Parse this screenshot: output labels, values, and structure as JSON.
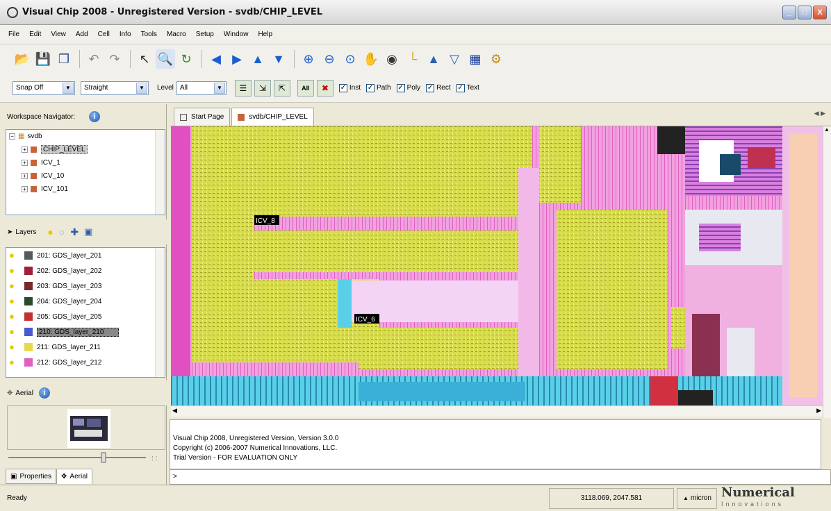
{
  "window": {
    "title": "Visual Chip 2008 - Unregistered Version - svdb/CHIP_LEVEL",
    "minimize": "_",
    "maximize": "□",
    "close": "X"
  },
  "menu": [
    "File",
    "Edit",
    "View",
    "Add",
    "Cell",
    "Info",
    "Tools",
    "Macro",
    "Setup",
    "Window",
    "Help"
  ],
  "toolbar2": {
    "snap": "Snap Off",
    "path_mode": "Straight",
    "level_label": "Level",
    "level_value": "All",
    "checks": [
      {
        "label": "Inst",
        "checked": true
      },
      {
        "label": "Path",
        "checked": true
      },
      {
        "label": "Poly",
        "checked": true
      },
      {
        "label": "Rect",
        "checked": true
      },
      {
        "label": "Text",
        "checked": true
      }
    ]
  },
  "navigator": {
    "title": "Workspace Navigator:",
    "root": "svdb",
    "items": [
      "CHIP_LEVEL",
      "ICV_1",
      "ICV_10",
      "ICV_101"
    ]
  },
  "layers": {
    "title": "Layers",
    "items": [
      {
        "name": "201: GDS_layer_201",
        "color": "#555a5c"
      },
      {
        "name": "202: GDS_layer_202",
        "color": "#a0203c"
      },
      {
        "name": "203: GDS_layer_203",
        "color": "#7a2a2a"
      },
      {
        "name": "204: GDS_layer_204",
        "color": "#2a4a2a"
      },
      {
        "name": "205: GDS_layer_205",
        "color": "#c43030"
      },
      {
        "name": "210: GDS_layer_210",
        "color": "#4a5ad0"
      },
      {
        "name": "211: GDS_layer_211",
        "color": "#e8d850"
      },
      {
        "name": "212: GDS_layer_212",
        "color": "#e060c0"
      }
    ],
    "selected_index": 5
  },
  "aerial": {
    "title": "Aerial"
  },
  "bottom_tabs": [
    "Properties",
    "Aerial"
  ],
  "doc_tabs": [
    "Start Page",
    "svdb/CHIP_LEVEL"
  ],
  "canvas_labels": [
    "ICV_8",
    "ICV_6"
  ],
  "console": [
    "Visual Chip 2008,  Unregistered Version,  Version 3.0.0",
    "Copyright (c) 2006-2007  Numerical Innovations, LLC.",
    "Trial Version - FOR EVALUATION ONLY"
  ],
  "cmd_prompt": ">",
  "status": {
    "text": "Ready",
    "coords": "3118.069, 2047.581",
    "units": "micron",
    "logo": "Numerical",
    "logo_sub": "Innovations"
  }
}
